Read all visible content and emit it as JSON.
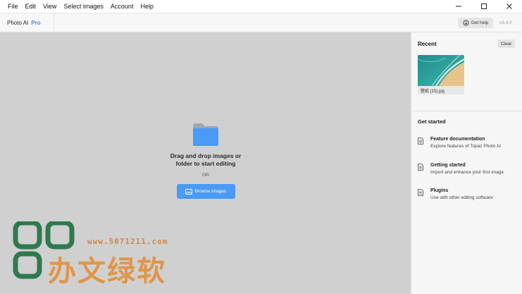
{
  "menubar": {
    "items": [
      "File",
      "Edit",
      "View",
      "Select images",
      "Account",
      "Help"
    ]
  },
  "window_controls": {
    "icons": [
      "minimize-icon",
      "maximize-icon",
      "close-icon"
    ]
  },
  "header": {
    "brand_name": "Photo AI",
    "brand_tier": "Pro",
    "help_label": "Get help",
    "version": "v3.4.0"
  },
  "dropzone": {
    "icon": "folder-icon",
    "line1": "Drag and drop images or",
    "line2": "folder to start editing",
    "or_label": "OR",
    "browse_label": "Browse images"
  },
  "watermark": {
    "url": "www.5071211.com",
    "text": "办文绿软"
  },
  "sidebar": {
    "recent_title": "Recent",
    "clear_label": "Clear",
    "recent_items": [
      {
        "filename": "壁纸 (15).jpg"
      }
    ],
    "get_started_title": "Get started",
    "get_started_items": [
      {
        "title": "Feature documentation",
        "description": "Explore features of Topaz Photo AI"
      },
      {
        "title": "Getting started",
        "description": "Import and enhance your first image"
      },
      {
        "title": "Plugins",
        "description": "Use with other editing software"
      }
    ]
  },
  "colors": {
    "accent": "#4a9af7",
    "brand_tier": "#3d8bf2",
    "workspace_bg": "#d0d0d0",
    "sidebar_bg": "#f6f6f6",
    "watermark_green": "#2e7a4e",
    "watermark_orange": "#e0954a"
  }
}
